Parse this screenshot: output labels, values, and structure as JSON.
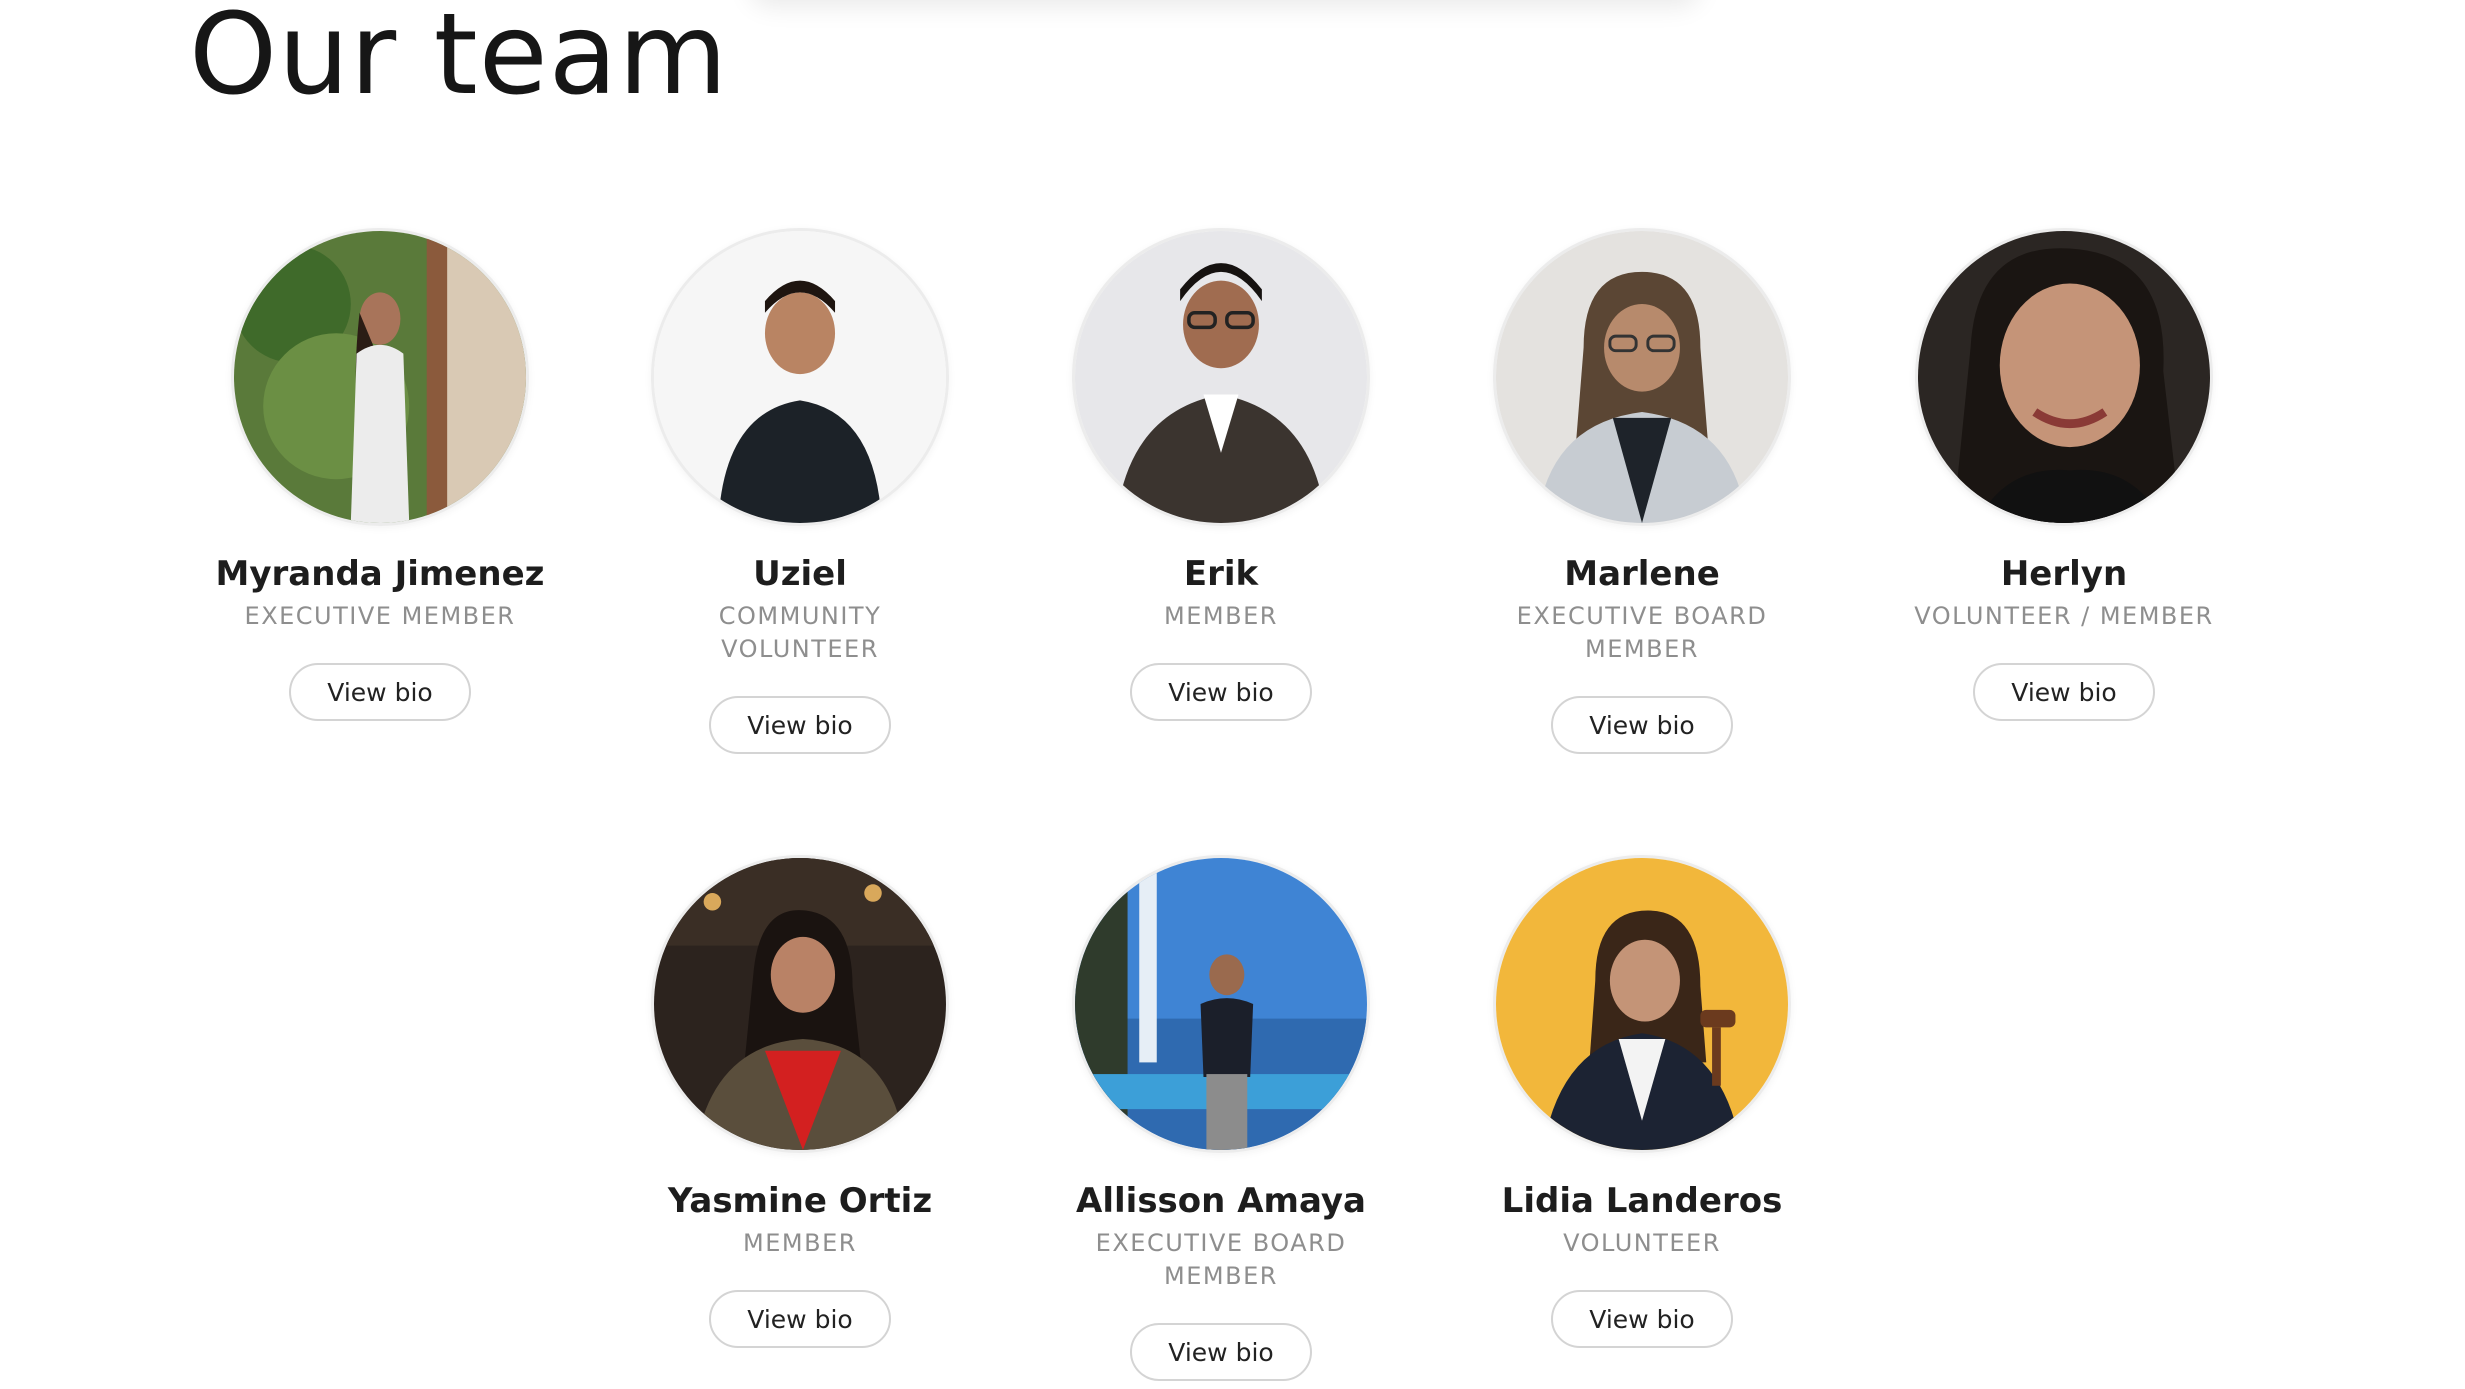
{
  "page": {
    "title": "Our team"
  },
  "members": [
    {
      "name": "Myranda Jimenez",
      "role": "EXECUTIVE MEMBER",
      "button": "View bio"
    },
    {
      "name": "Uziel",
      "role": "COMMUNITY VOLUNTEER",
      "button": "View bio"
    },
    {
      "name": "Erik",
      "role": "MEMBER",
      "button": "View bio"
    },
    {
      "name": "Marlene",
      "role": "EXECUTIVE BOARD MEMBER",
      "button": "View bio"
    },
    {
      "name": "Herlyn",
      "role": "VOLUNTEER / MEMBER",
      "button": "View bio"
    },
    {
      "name": "Yasmine Ortiz",
      "role": "MEMBER",
      "button": "View bio"
    },
    {
      "name": "Allisson Amaya",
      "role": "EXECUTIVE BOARD MEMBER",
      "button": "View bio"
    },
    {
      "name": "Lidia Landeros",
      "role": "VOLUNTEER",
      "button": "View bio"
    }
  ],
  "colors": {
    "text_primary": "#1d1d1d",
    "text_muted": "#8e8e8e",
    "button_border": "#d4d4d4",
    "background": "#ffffff"
  }
}
